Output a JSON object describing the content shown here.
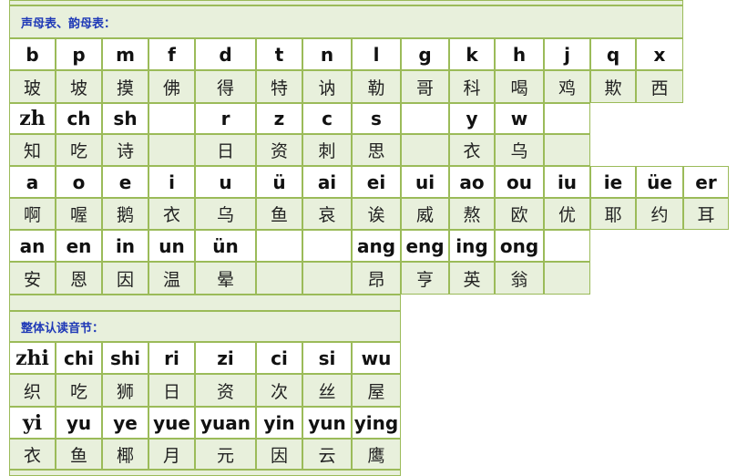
{
  "section1_title": "声母表、韵母表：",
  "section2_title": "整体认读音节：",
  "rows": [
    {
      "kind": "py",
      "cells": [
        "b",
        "p",
        "m",
        "f",
        "d",
        "t",
        "n",
        "l",
        "g",
        "k",
        "h",
        "j",
        "q",
        "x"
      ]
    },
    {
      "kind": "hz",
      "cells": [
        "玻",
        "坡",
        "摸",
        "佛",
        "得",
        "特",
        "讷",
        "勒",
        "哥",
        "科",
        "喝",
        "鸡",
        "欺",
        "西"
      ]
    },
    {
      "kind": "py",
      "cells": [
        "zh",
        "ch",
        "sh",
        "",
        "r",
        "z",
        "c",
        "s",
        "",
        "y",
        "w",
        ""
      ]
    },
    {
      "kind": "hz",
      "cells": [
        "知",
        "吃",
        "诗",
        "",
        "日",
        "资",
        "刺",
        "思",
        "",
        "衣",
        "乌",
        ""
      ]
    },
    {
      "kind": "py",
      "cells": [
        "a",
        "o",
        "e",
        "i",
        "u",
        "ü",
        "ai",
        "ei",
        "ui",
        "ao",
        "ou",
        "iu",
        "ie",
        "üe",
        "er"
      ]
    },
    {
      "kind": "hz",
      "cells": [
        "啊",
        "喔",
        "鹅",
        "衣",
        "乌",
        "鱼",
        "哀",
        "诶",
        "威",
        "熬",
        "欧",
        "优",
        "耶",
        "约",
        "耳"
      ]
    },
    {
      "kind": "py",
      "cells": [
        "an",
        "en",
        "in",
        "un",
        "ün",
        "",
        "",
        "ang",
        "eng",
        "ing",
        "ong",
        ""
      ]
    },
    {
      "kind": "hz",
      "cells": [
        "安",
        "恩",
        "因",
        "温",
        "晕",
        "",
        "",
        "昂",
        "亨",
        "英",
        "翁",
        ""
      ]
    },
    {
      "kind": "py",
      "cells": [
        "zhi",
        "chi",
        "shi",
        "ri",
        "zi",
        "ci",
        "si",
        "wu"
      ]
    },
    {
      "kind": "hz",
      "cells": [
        "织",
        "吃",
        "狮",
        "日",
        "资",
        "次",
        "丝",
        "屋"
      ]
    },
    {
      "kind": "py",
      "cells": [
        "yi",
        "yu",
        "ye",
        "yue",
        "yuan",
        "yin",
        "yun",
        "ying"
      ]
    },
    {
      "kind": "hz",
      "cells": [
        "衣",
        "鱼",
        "椰",
        "月",
        "元",
        "因",
        "云",
        "鹰"
      ]
    }
  ]
}
